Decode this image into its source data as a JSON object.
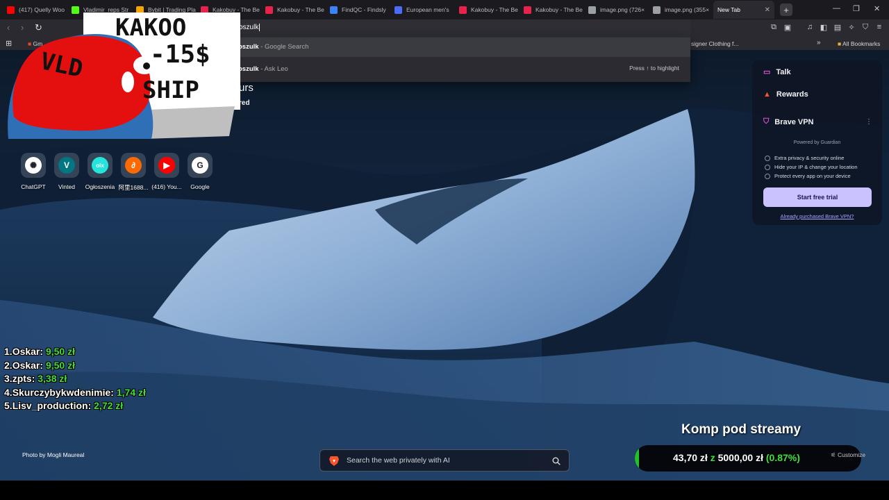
{
  "tabs": [
    {
      "title": "(417) Quelly Woo",
      "icon": "youtube-icon",
      "color": "#ff0000"
    },
    {
      "title": "Vladimir_reps Str",
      "icon": "kick-icon",
      "color": "#53fc18"
    },
    {
      "title": "Bybit | Trading Pla",
      "icon": "bybit-icon",
      "color": "#f7a600"
    },
    {
      "title": "Kakobuy - The Be",
      "icon": "kakobuy-icon",
      "color": "#e8234b"
    },
    {
      "title": "Kakobuy - The Be",
      "icon": "kakobuy-icon",
      "color": "#e8234b"
    },
    {
      "title": "FindQC - Findsly",
      "icon": "findqc-icon",
      "color": "#3b82f6"
    },
    {
      "title": "European men's",
      "icon": "site-icon",
      "color": "#4a6cf7"
    },
    {
      "title": "Kakobuy - The Be",
      "icon": "kakobuy-icon",
      "color": "#e8234b"
    },
    {
      "title": "Kakobuy - The Be",
      "icon": "kakobuy-icon",
      "color": "#e8234b"
    },
    {
      "title": "image.png (726×",
      "icon": "globe-icon",
      "color": "#9aa0a6"
    },
    {
      "title": "image.png (355×",
      "icon": "globe-icon",
      "color": "#9aa0a6"
    },
    {
      "title": "New Tab",
      "icon": "",
      "color": "#2a2a30"
    }
  ],
  "address_bar": {
    "value": "oszulk"
  },
  "bookmarks": {
    "first": "Gm",
    "designer": "signer Clothing f...",
    "all": "All Bookmarks"
  },
  "suggestions": [
    {
      "bold": "oszulk",
      "rest": " - Google Search"
    },
    {
      "bold": "oszulk",
      "rest": " - Ask Leo",
      "hint": "Press ↑ to highlight"
    }
  ],
  "sticker": {
    "line1": "KAKOO",
    "line2": "-15$",
    "line3": "SHIP",
    "line4": "VLD"
  },
  "hidden_card": {
    "line1": "urs",
    "line2": "red"
  },
  "shortcuts": [
    {
      "label": "ChatGPT",
      "icon": "chatgpt-icon",
      "color": "#ffffff",
      "glyph": "✺"
    },
    {
      "label": "Vinted",
      "icon": "vinted-icon",
      "color": "#007782",
      "glyph": "V"
    },
    {
      "label": "Ogłoszenia",
      "icon": "olx-icon",
      "color": "#23e5db",
      "glyph": "olx"
    },
    {
      "label": "阿里1688...",
      "icon": "alibaba-icon",
      "color": "#ff6a00",
      "glyph": "∂"
    },
    {
      "label": "(416) You...",
      "icon": "youtube-icon",
      "color": "#ff0000",
      "glyph": "▶"
    },
    {
      "label": "Google",
      "icon": "google-icon",
      "color": "#ffffff",
      "glyph": "G"
    }
  ],
  "brave_panel": {
    "talk": "Talk",
    "rewards": "Rewards",
    "vpn": "Brave VPN",
    "powered": "Powered by  Guardian",
    "features": [
      "Extra privacy & security online",
      "Hide your IP & change your location",
      "Protect every app on your device"
    ],
    "trial": "Start free trial",
    "already": "Already purchased Brave VPN?"
  },
  "leaderboard": [
    {
      "rank": "1.",
      "name": "Oskar:",
      "amount": "9,50 zł"
    },
    {
      "rank": "2.",
      "name": "Oskar:",
      "amount": "9,50 zł"
    },
    {
      "rank": "3.",
      "name": "zpts:",
      "amount": "3,38 zł"
    },
    {
      "rank": "4.",
      "name": "Skurczybykwdenimie:",
      "amount": "1,74 zł"
    },
    {
      "rank": "5.",
      "name": "Lisv_production:",
      "amount": "2,72 zł"
    }
  ],
  "photo_credit": "Photo by Mogli Maureal",
  "search": {
    "placeholder": "Search the web privately with AI"
  },
  "goal": {
    "title": "Komp pod streamy",
    "current": "43,70 zł",
    "sep": "z",
    "target": "5000,00 zł",
    "percent_label": "(0.87%)",
    "percent": 0.0087
  },
  "customize": "Customize",
  "colors": {
    "accent_green": "#42e03a",
    "brave_violet": "#c9c2ff",
    "brave_orange": "#fb542b"
  }
}
